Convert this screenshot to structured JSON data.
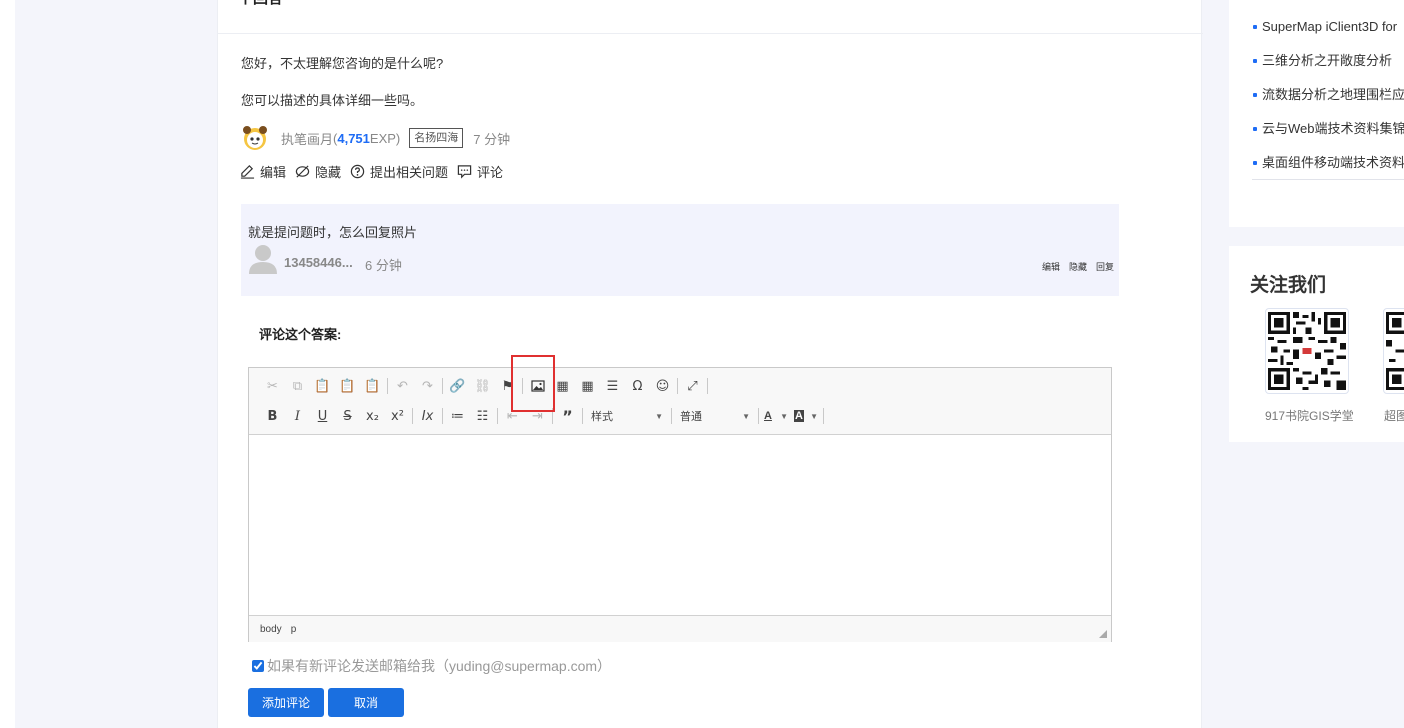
{
  "main": {
    "title": "个回答",
    "answer_paragraphs": [
      "您好，不太理解您咨询的是什么呢?",
      "您可以描述的具体详细一些吗。"
    ],
    "author": {
      "name": "执笔画月",
      "exp_open": " (",
      "exp": "4,751",
      "exp_suffix": "EXP)",
      "badge": "名扬四海",
      "time": "7 分钟"
    },
    "actions": {
      "edit": "编辑",
      "hide": "隐藏",
      "ask_related": "提出相关问题",
      "comment": "评论"
    },
    "comment": {
      "text": "就是提问题时，怎么回复照片",
      "user": "13458446...",
      "time": "6 分钟",
      "edit": "编辑",
      "hide": "隐藏",
      "reply": "回复"
    },
    "comment_form_label": "评论这个答案:",
    "editor": {
      "styles_label": "样式",
      "format_label": "普通",
      "font_color_label": "A",
      "bg_color_label": "A",
      "status_path": [
        "body",
        "p"
      ]
    },
    "email_notify": {
      "label": "如果有新评论发送邮箱给我（yuding@supermap.com）",
      "checked": true
    },
    "add_button": "添加评论",
    "cancel_button": "取消"
  },
  "sidebar": {
    "articles": [
      "SuperMap iClient3D for",
      "三维分析之开敞度分析",
      "流数据分析之地理围栏应用",
      "云与Web端技术资料集锦",
      "桌面组件移动端技术资料集"
    ],
    "follow_title": "关注我们",
    "qr_labels": [
      "917书院GIS学堂",
      "超图"
    ]
  },
  "colors": {
    "accent": "#1a6fe0",
    "highlight": "#e03030",
    "comment_bg": "#f2f3fd"
  }
}
